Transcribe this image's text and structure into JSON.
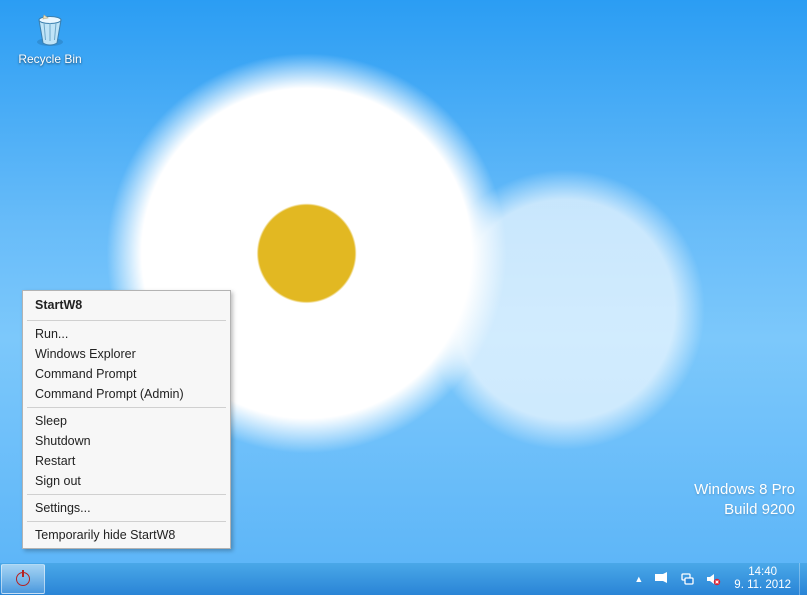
{
  "desktop": {
    "icons": {
      "recycle_bin": {
        "label": "Recycle Bin"
      }
    },
    "watermark": {
      "line1": "Windows 8 Pro",
      "line2": "Build 9200"
    }
  },
  "context_menu": {
    "title": "StartW8",
    "group1": [
      "Run...",
      "Windows Explorer",
      "Command Prompt",
      "Command Prompt (Admin)"
    ],
    "group2": [
      "Sleep",
      "Shutdown",
      "Restart",
      "Sign out"
    ],
    "group3": [
      "Settings..."
    ],
    "group4": [
      "Temporarily hide StartW8"
    ]
  },
  "taskbar": {
    "running_app": "StartW8",
    "tray": {
      "arrow_tooltip": "Show hidden icons",
      "action_center": "Action Center",
      "network": "Network",
      "volume": "Volume (muted)"
    },
    "clock": {
      "time": "14:40",
      "date": "9. 11. 2012"
    }
  }
}
